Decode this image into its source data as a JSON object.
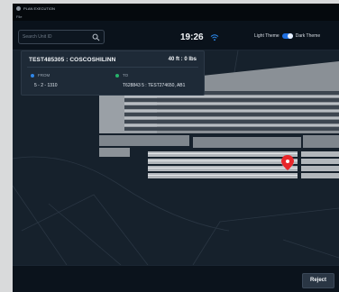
{
  "window": {
    "title": "PLAN EXECUTION",
    "menu_label": "File"
  },
  "header": {
    "search_placeholder": "Search Unit ID",
    "time": "19:26",
    "light_theme_label": "Light Theme",
    "dark_theme_label": "Dark Theme",
    "dark_theme_enabled": true
  },
  "info_card": {
    "title": "TEST485305 : COSCOSHILINN",
    "size": "40 ft : 0 lbs",
    "from_label": "FROM",
    "from_value": "5 - 2 - 1310",
    "to_label": "TO",
    "to_value": "T628843 5 : TEST274650, AB1"
  },
  "footer": {
    "reject_label": "Reject"
  },
  "colors": {
    "from_dot": "#2f86e8",
    "to_dot": "#27b36a",
    "accent": "#1f6fe0",
    "location_pin": "#e8262a"
  },
  "icons": [
    "search-icon",
    "wifi-icon",
    "location-pin-icon"
  ]
}
